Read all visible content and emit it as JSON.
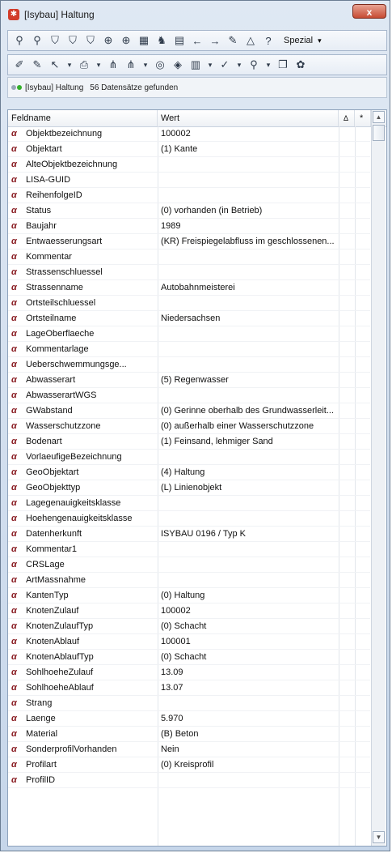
{
  "window": {
    "title": "[Isybau] Haltung",
    "close_label": "x"
  },
  "toolbar1": {
    "icons": [
      "binoculars-icon",
      "binoculars-next-icon",
      "filter-icon",
      "filter-add-icon",
      "filter-remove-icon",
      "zoom-selection-icon",
      "zoom-add-icon",
      "chart-icon",
      "find-icon",
      "table-icon",
      "back-arrow-icon",
      "forward-arrow-icon",
      "edit-icon",
      "measure-icon",
      "help-icon"
    ],
    "spezial_label": "Spezial",
    "spezial_arrow": "▾"
  },
  "toolbar2": {
    "icons": [
      "pencil-icon",
      "pencil-edit-icon",
      "select-icon",
      "dropdown-icon",
      "export-icon",
      "dropdown-icon",
      "network-icon",
      "network-add-icon",
      "dropdown-icon",
      "zoom-icon",
      "map-icon",
      "report-icon",
      "dropdown-icon",
      "check-icon",
      "dropdown-icon",
      "magnify-icon",
      "dropdown-icon",
      "copy-icon",
      "plugin-icon"
    ]
  },
  "status": {
    "layer": "[Isybau] Haltung",
    "count_text": "56 Datensätze gefunden",
    "dot_colors": [
      "#9aa8b8",
      "#34b02a"
    ]
  },
  "grid": {
    "columns": [
      "Feldname",
      "Wert",
      "Δ",
      "*"
    ],
    "field_icon_glyph": "α",
    "rows": [
      {
        "name": "Objektbezeichnung",
        "value": "100002"
      },
      {
        "name": "Objektart",
        "value": "(1) Kante"
      },
      {
        "name": "AlteObjektbezeichnung",
        "value": ""
      },
      {
        "name": "LISA-GUID",
        "value": ""
      },
      {
        "name": "ReihenfolgeID",
        "value": ""
      },
      {
        "name": "Status",
        "value": "(0) vorhanden (in Betrieb)"
      },
      {
        "name": "Baujahr",
        "value": "1989"
      },
      {
        "name": "Entwaesserungsart",
        "value": "(KR) Freispiegelabfluss im geschlossenen..."
      },
      {
        "name": "Kommentar",
        "value": ""
      },
      {
        "name": "Strassenschluessel",
        "value": ""
      },
      {
        "name": "Strassenname",
        "value": "Autobahnmeisterei"
      },
      {
        "name": "Ortsteilschluessel",
        "value": ""
      },
      {
        "name": "Ortsteilname",
        "value": "Niedersachsen"
      },
      {
        "name": "LageOberflaeche",
        "value": ""
      },
      {
        "name": "Kommentarlage",
        "value": ""
      },
      {
        "name": "Ueberschwemmungsge...",
        "value": ""
      },
      {
        "name": "Abwasserart",
        "value": "(5) Regenwasser"
      },
      {
        "name": "AbwasserartWGS",
        "value": ""
      },
      {
        "name": "GWabstand",
        "value": "(0) Gerinne oberhalb des Grundwasserleit..."
      },
      {
        "name": "Wasserschutzzone",
        "value": "(0) außerhalb einer Wasserschutzzone"
      },
      {
        "name": "Bodenart",
        "value": "(1) Feinsand, lehmiger Sand"
      },
      {
        "name": "VorlaeufigeBezeichnung",
        "value": ""
      },
      {
        "name": "GeoObjektart",
        "value": "(4) Haltung"
      },
      {
        "name": "GeoObjekttyp",
        "value": "(L) Linienobjekt"
      },
      {
        "name": "Lagegenauigkeitsklasse",
        "value": ""
      },
      {
        "name": "Hoehengenauigkeitsklasse",
        "value": ""
      },
      {
        "name": "Datenherkunft",
        "value": "ISYBAU 0196 / Typ K"
      },
      {
        "name": "Kommentar1",
        "value": ""
      },
      {
        "name": "CRSLage",
        "value": ""
      },
      {
        "name": "ArtMassnahme",
        "value": ""
      },
      {
        "name": "KantenTyp",
        "value": "(0) Haltung"
      },
      {
        "name": "KnotenZulauf",
        "value": "100002"
      },
      {
        "name": "KnotenZulaufTyp",
        "value": "(0) Schacht"
      },
      {
        "name": "KnotenAblauf",
        "value": "100001"
      },
      {
        "name": "KnotenAblaufTyp",
        "value": "(0) Schacht"
      },
      {
        "name": "SohlhoeheZulauf",
        "value": "13.09"
      },
      {
        "name": "SohlhoeheAblauf",
        "value": "13.07"
      },
      {
        "name": "Strang",
        "value": ""
      },
      {
        "name": "Laenge",
        "value": "5.970"
      },
      {
        "name": "Material",
        "value": "(B) Beton"
      },
      {
        "name": "SonderprofilVorhanden",
        "value": "Nein"
      },
      {
        "name": "Profilart",
        "value": "(0) Kreisprofil"
      },
      {
        "name": "ProfilID",
        "value": ""
      }
    ]
  },
  "scrollbar": {
    "up_glyph": "▲",
    "down_glyph": "▼"
  }
}
